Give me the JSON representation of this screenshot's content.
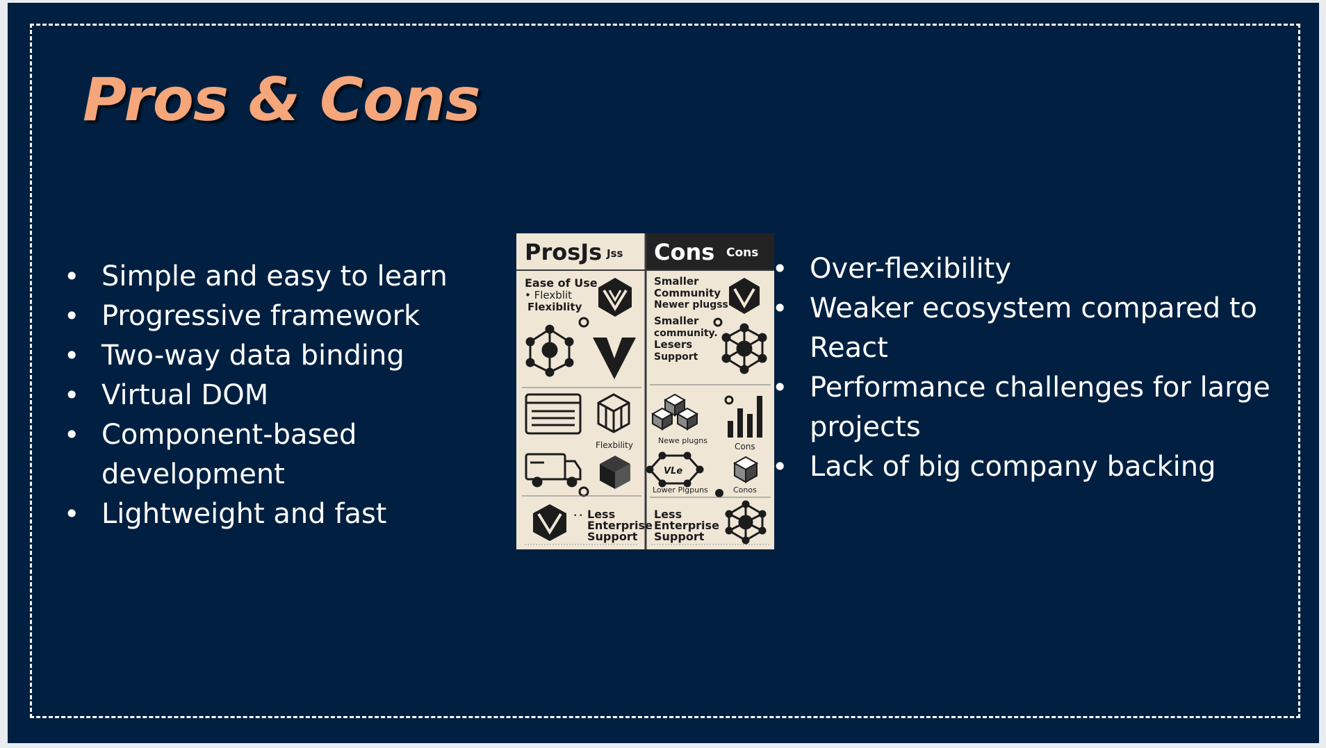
{
  "slide": {
    "title": "Pros & Cons"
  },
  "pros": {
    "items": [
      "Simple and easy to learn",
      "Progressive framework",
      "Two-way data binding",
      "Virtual DOM",
      "Component-based development",
      "Lightweight and fast"
    ]
  },
  "cons": {
    "items": [
      "Over-flexibility",
      "Weaker ecosystem compared to React",
      "Performance challenges for large projects",
      "Lack of big company backing"
    ]
  },
  "illustration": {
    "left_header": "ProsJs",
    "left_header_small": "Jss",
    "right_header": "Cons",
    "right_header_small": "Cons",
    "left_text_1": "Ease of Use",
    "left_text_2": "• Flexblit",
    "left_text_3": "Flexiblity",
    "left_label_flex": "Flexbility",
    "left_bottom_1": "Less",
    "left_bottom_2": "Enterprise",
    "left_bottom_3": "Support",
    "right_text_1": "Smaller",
    "right_text_2": "Community",
    "right_text_3": "Newer plugss",
    "right_text_4": "Smaller",
    "right_text_5": "community.",
    "right_text_6": "Lesers",
    "right_text_7": "Support",
    "right_label_newer": "Newe plugns",
    "right_label_cons": "Cons",
    "right_label_vle": "VLe",
    "right_label_lower": "Lower Plgpuns",
    "right_label_conos": "Conos",
    "right_bottom_1": "Less",
    "right_bottom_2": "Enterprise",
    "right_bottom_3": "Support",
    "colors": {
      "paper": "#efe6d6",
      "ink": "#1c1c1c",
      "header_dark": "#232323"
    }
  },
  "colors": {
    "background": "#012041",
    "title": "#f5a67a",
    "text": "#ffffff"
  }
}
